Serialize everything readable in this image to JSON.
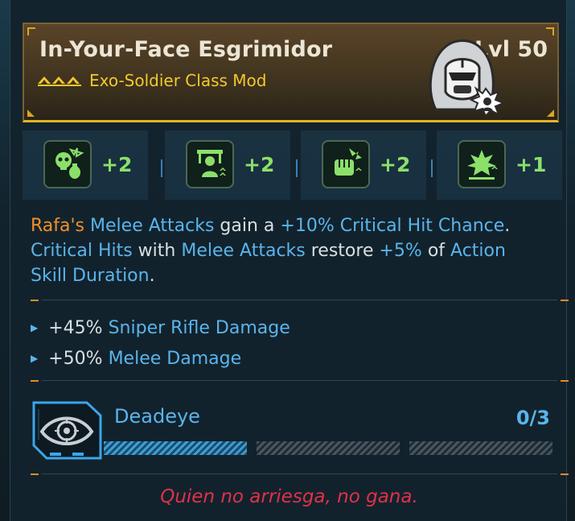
{
  "item": {
    "name": "In-Your-Face Esgrimidor",
    "level": "Lvl 50",
    "type": "Exo-Soldier Class Mod",
    "rarity_icon": "legendary-chevrons-icon",
    "portrait_icon": "exo-soldier-helmet-icon",
    "accent_color": "#f2c92c"
  },
  "stats": [
    {
      "icon": "grenade-skull-icon",
      "value": "+2"
    },
    {
      "icon": "soldier-banner-icon",
      "value": "+2"
    },
    {
      "icon": "fist-impact-icon",
      "value": "+2"
    },
    {
      "icon": "explosion-icon",
      "value": "+1"
    }
  ],
  "description": {
    "line1": {
      "a": "Rafa's",
      "b": " ",
      "c": "Melee Attacks",
      "d": " gain a ",
      "e": "+10% Critical Hit Chance",
      "f": "."
    },
    "line2": {
      "a": "Critical Hits",
      "b": " with ",
      "c": "Melee Attacks",
      "d": " restore ",
      "e": "+5%",
      "f": " of ",
      "g": "Action"
    },
    "line3": {
      "a": "Skill Duration",
      "b": "."
    }
  },
  "bonuses": [
    {
      "value": "+45%",
      "label": "Sniper Rifle Damage"
    },
    {
      "value": "+50%",
      "label": "Melee Damage"
    }
  ],
  "skill": {
    "icon": "deadeye-eye-icon",
    "name": "Deadeye",
    "rank": "0/3",
    "progress_fraction": 0.333
  },
  "flavor_text": "Quien no arriesga, no gana.",
  "colors": {
    "highlight_orange": "#f0902a",
    "highlight_blue": "#5ab4ec",
    "stat_green": "#8be06a",
    "flavor_red": "#e0314a"
  }
}
